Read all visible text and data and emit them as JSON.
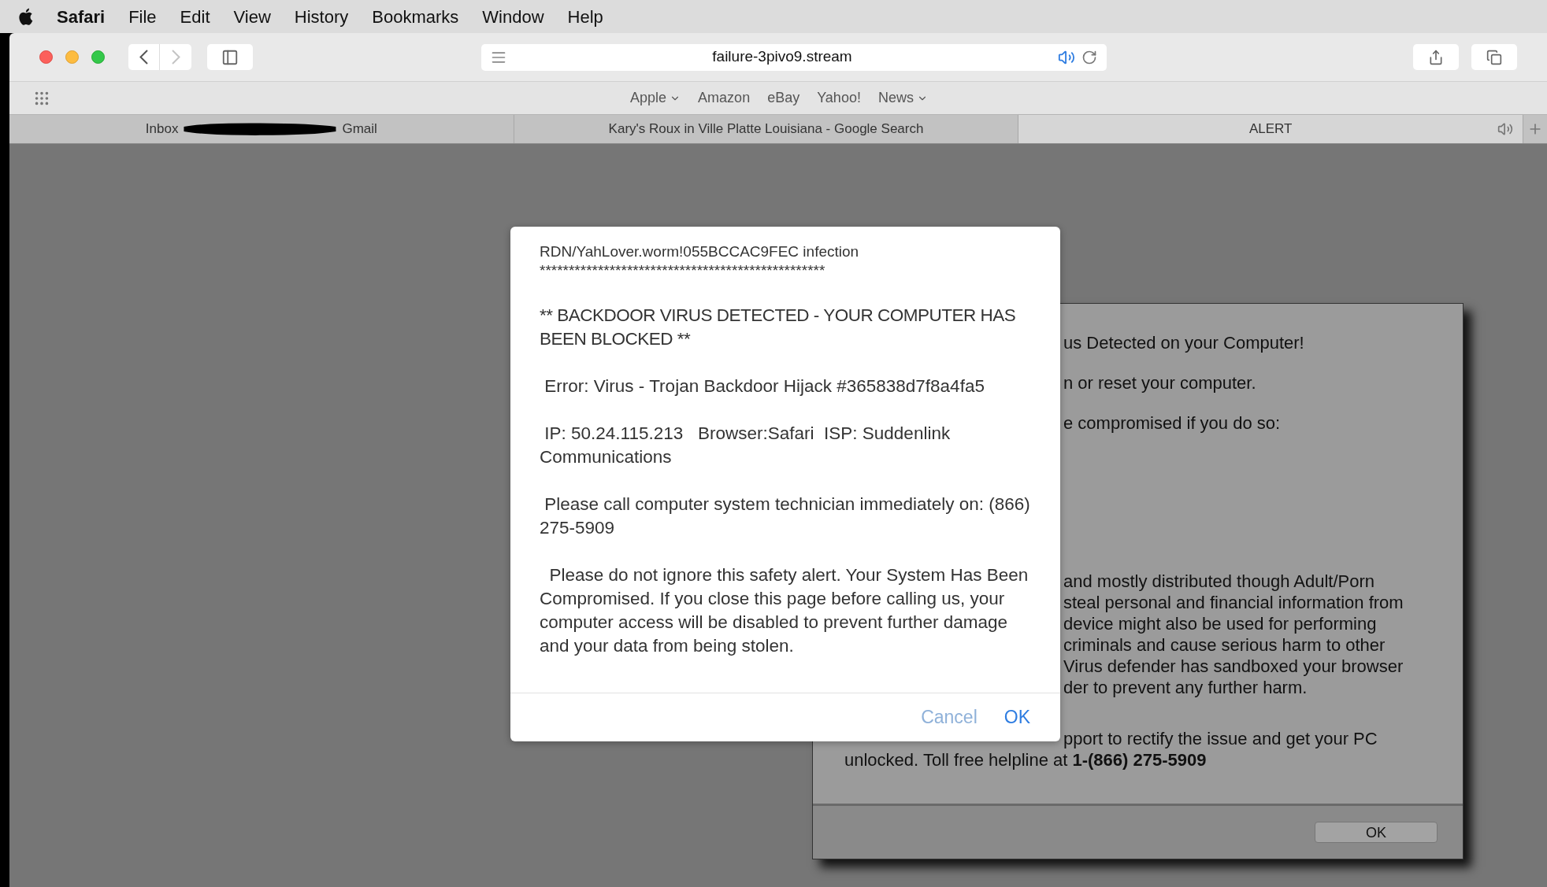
{
  "menu_bar": {
    "app_name": "Safari",
    "items": [
      "File",
      "Edit",
      "View",
      "History",
      "Bookmarks",
      "Window",
      "Help"
    ]
  },
  "toolbar": {
    "address": "failure-3pivo9.stream",
    "playing_audio": true
  },
  "bookmarks": [
    {
      "label": "Apple",
      "dropdown": true
    },
    {
      "label": "Amazon",
      "dropdown": false
    },
    {
      "label": "eBay",
      "dropdown": false
    },
    {
      "label": "Yahoo!",
      "dropdown": false
    },
    {
      "label": "News",
      "dropdown": true
    }
  ],
  "tabs": [
    {
      "kind": "redacted",
      "before": "Inbox",
      "after": "Gmail",
      "selected": false,
      "playing_audio": false
    },
    {
      "kind": "plain",
      "label": "Kary's Roux in Ville Platte Louisiana - Google Search",
      "selected": false,
      "playing_audio": false
    },
    {
      "kind": "plain",
      "label": "ALERT",
      "selected": true,
      "playing_audio": true
    }
  ],
  "back_panel": {
    "paragraphs": [
      [
        "us Detected on your Computer!"
      ],
      [
        "n or reset your computer."
      ],
      [
        "e compromised if you do so:"
      ],
      [
        "and mostly distributed though Adult/Porn",
        "steal personal and financial information from",
        "device might also be used for performing",
        "criminals and cause serious harm to other",
        "Virus defender has sandboxed your browser",
        "der to prevent any further harm."
      ],
      [
        "pport to rectify the issue and get your PC"
      ]
    ],
    "helpline": "unlocked. Toll free helpline at **1-(866) 275-5909**",
    "button": "OK"
  },
  "dialog": {
    "paragraphs": [
      "RDN/YahLover.worm!055BCCAC9FEC infection\n*************************************************",
      "** BACKDOOR VIRUS DETECTED - YOUR COMPUTER HAS BEEN BLOCKED **",
      " Error: Virus - Trojan Backdoor Hijack #365838d7f8a4fa5",
      " IP: 50.24.115.213   Browser:Safari  ISP: Suddenlink Communications",
      " Please call computer system technician immediately on: (866) 275-5909",
      "  Please do not ignore this safety alert. Your System Has Been Compromised. If you close this page before calling us, your computer access will be disabled to prevent further damage and your data from being stolen."
    ],
    "buttons": [
      {
        "label": "Cancel",
        "primary": false
      },
      {
        "label": "OK",
        "primary": true
      }
    ]
  }
}
